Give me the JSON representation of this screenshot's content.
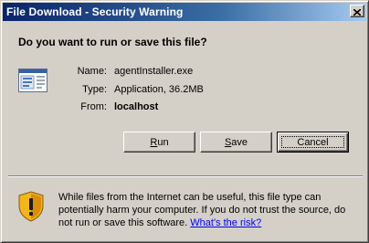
{
  "window": {
    "title": "File Download - Security Warning",
    "close_label": "Close"
  },
  "dialog": {
    "question": "Do you want to run or save this file?"
  },
  "file": {
    "name_label": "Name:",
    "name_value": "agentInstaller.exe",
    "type_label": "Type:",
    "type_value": "Application, 36.2MB",
    "from_label": "From:",
    "from_value": "localhost"
  },
  "buttons": {
    "run_mnemonic": "R",
    "run_rest": "un",
    "save_mnemonic": "S",
    "save_rest": "ave",
    "cancel_label": "Cancel"
  },
  "warning": {
    "text": "While files from the Internet can be useful, this file type can potentially harm your computer. If you do not trust the source, do not run or save this software.",
    "link_text": "What's the risk?"
  },
  "icons": {
    "file": "application-file-icon",
    "warning": "security-shield-icon"
  },
  "colors": {
    "titlebar_start": "#0a246a",
    "titlebar_end": "#a6caf0",
    "dialog_background": "#d4d0c8",
    "link": "#0000ff"
  }
}
